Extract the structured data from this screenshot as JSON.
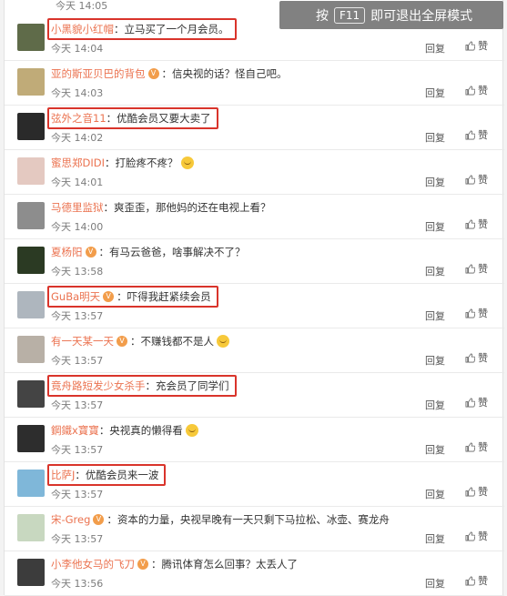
{
  "top_partial": {
    "time": "今天 14:05",
    "reply": "回复",
    "like": "赞"
  },
  "fullscreen_tip": {
    "prefix": "按",
    "key": "F11",
    "suffix": "即可退出全屏模式"
  },
  "actions": {
    "reply": "回复",
    "like": "赞"
  },
  "comments": [
    {
      "user": "小黑貌小红帽",
      "vip": false,
      "text": "：立马买了一个月会员。",
      "time": "今天 14:04",
      "highlight": true,
      "emoji": false
    },
    {
      "user": "亚的斯亚贝巴的背包",
      "vip": true,
      "text": "：信央视的话？怪自己吧。",
      "time": "今天 14:03",
      "highlight": false,
      "emoji": false
    },
    {
      "user": "弦外之音11",
      "vip": false,
      "text": "：优酷会员又要大卖了",
      "time": "今天 14:02",
      "highlight": true,
      "emoji": false
    },
    {
      "user": "蜜思郑DIDI",
      "vip": false,
      "text": "：打脸疼不疼？",
      "time": "今天 14:01",
      "highlight": false,
      "emoji": true
    },
    {
      "user": "马德里监狱",
      "vip": false,
      "text": "：爽歪歪，那他妈的还在电视上看？",
      "time": "今天 14:00",
      "highlight": false,
      "emoji": false
    },
    {
      "user": "夏杨阳",
      "vip": true,
      "text": "：有马云爸爸，啥事解决不了？",
      "time": "今天 13:58",
      "highlight": false,
      "emoji": false
    },
    {
      "user": "GuBa明天",
      "vip": true,
      "text": "：吓得我赶紧续会员",
      "time": "今天 13:57",
      "highlight": true,
      "emoji": false
    },
    {
      "user": "有一天某一天",
      "vip": true,
      "text": "：不赚钱都不是人",
      "time": "今天 13:57",
      "highlight": false,
      "emoji": true
    },
    {
      "user": "竟舟路短发少女杀手",
      "vip": false,
      "text": "：充会员了同学们",
      "time": "今天 13:57",
      "highlight": true,
      "emoji": false
    },
    {
      "user": "鋼鐵x寶寶",
      "vip": false,
      "text": "：央视真的懒得看",
      "time": "今天 13:57",
      "highlight": false,
      "emoji": true
    },
    {
      "user": "比萨J",
      "vip": false,
      "text": "：优酷会员来一波",
      "time": "今天 13:57",
      "highlight": true,
      "emoji": false
    },
    {
      "user": "宋-Greg",
      "vip": true,
      "text": "：资本的力量，央视早晚有一天只剩下马拉松、冰壶、赛龙舟",
      "time": "今天 13:57",
      "highlight": false,
      "emoji": false
    },
    {
      "user": "小李他女马的飞刀",
      "vip": true,
      "text": "：腾讯体育怎么回事？太丢人了",
      "time": "今天 13:56",
      "highlight": false,
      "emoji": false
    }
  ],
  "avatar_colors": [
    "#5f6b49",
    "#c0ab78",
    "#2a2a2a",
    "#e4c9c1",
    "#8d8d8d",
    "#2b3a23",
    "#aeb6be",
    "#b8b0a6",
    "#444444",
    "#2d2d2d",
    "#7fb7d9",
    "#c8d8c0",
    "#3c3c3c"
  ],
  "colors": {
    "username": "#eb7350",
    "highlight": "#d9342b"
  }
}
